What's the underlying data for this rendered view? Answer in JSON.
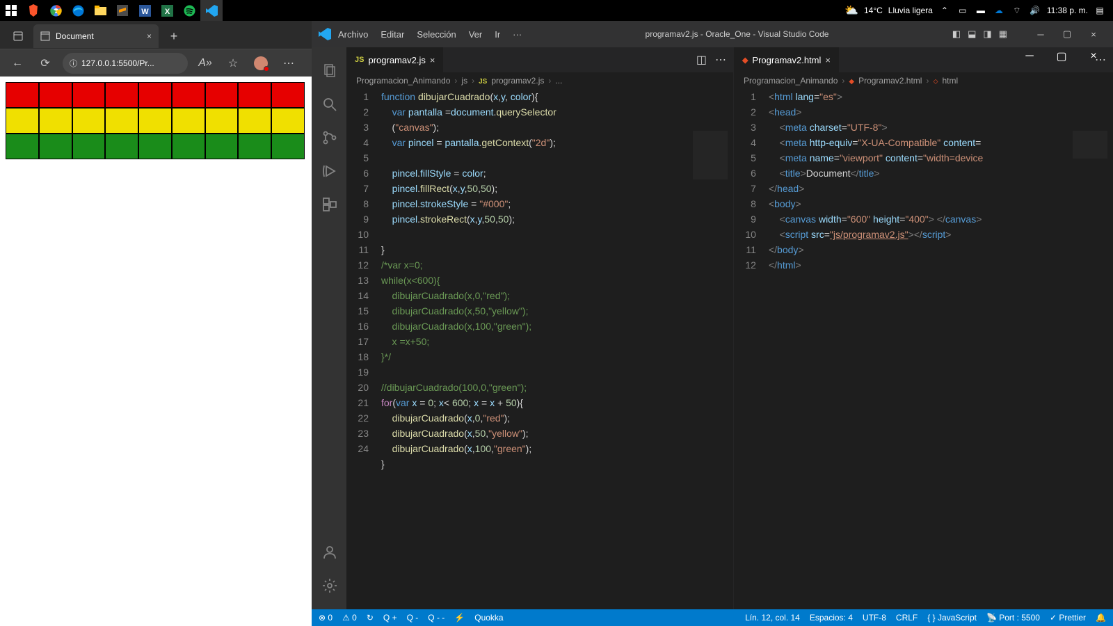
{
  "taskbar": {
    "weather_temp": "14°C",
    "weather_desc": "Lluvia ligera",
    "time": "11:38 p. m."
  },
  "browser": {
    "tab_title": "Document",
    "url": "127.0.0.1:5500/Pr...",
    "canvas_rows": [
      {
        "color": "#e60000"
      },
      {
        "color": "#f0e000"
      },
      {
        "color": "#1a8c1a"
      }
    ]
  },
  "vscode": {
    "menu": [
      "Archivo",
      "Editar",
      "Selección",
      "Ver",
      "Ir",
      "···"
    ],
    "title": "programav2.js - Oracle_One - Visual Studio Code",
    "left_tab": "programav2.js",
    "right_tab": "Programav2.html",
    "left_breadcrumb": [
      "Programacion_Animando",
      "js",
      "programav2.js",
      "..."
    ],
    "right_breadcrumb": [
      "Programacion_Animando",
      "Programav2.html",
      "html"
    ],
    "js_lines": [
      "function dibujarCuadrado(x,y, color){",
      "    var pantalla =document.querySelector\n    (\"canvas\");",
      "    var pincel = pantalla.getContext(\"2d\");",
      "",
      "    pincel.fillStyle = color;",
      "    pincel.fillRect(x,y,50,50);",
      "    pincel.strokeStyle = \"#000\";",
      "    pincel.strokeRect(x,y,50,50);",
      "",
      "}",
      "/*var x=0;",
      "while(x<600){",
      "    dibujarCuadrado(x,0,\"red\");",
      "    dibujarCuadrado(x,50,\"yellow\");",
      "    dibujarCuadrado(x,100,\"green\");",
      "    x =x+50;",
      "}*/",
      "",
      "//dibujarCuadrado(100,0,\"green\");",
      "for(var x = 0; x< 600; x = x + 50){",
      "    dibujarCuadrado(x,0,\"red\");",
      "    dibujarCuadrado(x,50,\"yellow\");",
      "    dibujarCuadrado(x,100,\"green\");",
      "}"
    ],
    "html_lines": [
      "<html lang=\"es\">",
      "<head>",
      "    <meta charset=\"UTF-8\">",
      "    <meta http-equiv=\"X-UA-Compatible\" content=",
      "    <meta name=\"viewport\" content=\"width=device",
      "    <title>Document</title>",
      "</head>",
      "<body>",
      "    <canvas width=\"600\" height=\"400\"> </canvas>",
      "    <script src=\"js/programav2.js\"></script>",
      "</body>",
      "</html>"
    ],
    "status": {
      "errors": "0",
      "warnings": "0",
      "q1": "Q +",
      "q2": "Q -",
      "q3": "Q - -",
      "quokka": "Quokka",
      "position": "Lín. 12, col. 14",
      "spaces": "Espacios: 4",
      "encoding": "UTF-8",
      "eol": "CRLF",
      "lang": "JavaScript",
      "port": "Port : 5500",
      "prettier": "Prettier"
    }
  }
}
